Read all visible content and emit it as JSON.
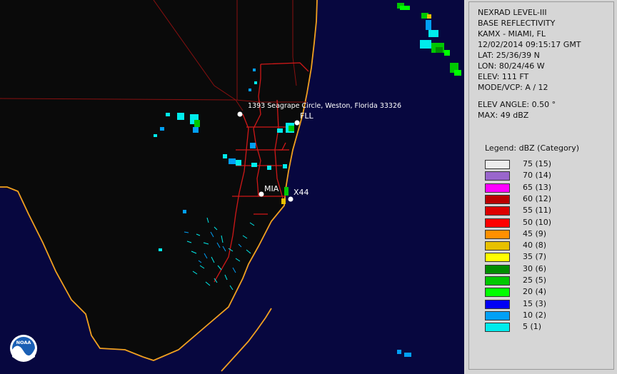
{
  "header": {
    "product": "NEXRAD LEVEL-III",
    "type": "BASE REFLECTIVITY",
    "station": "KAMX - MIAMI, FL",
    "datetime": "12/02/2014 09:15:17 GMT",
    "lat": "LAT: 25/36/39 N",
    "lon": "LON: 80/24/46 W",
    "elev": "ELEV: 111 FT",
    "mode": "MODE/VCP: A / 12",
    "elev_angle": "ELEV ANGLE: 0.50 °",
    "max": "MAX: 49 dBZ"
  },
  "legend": {
    "title": "Legend: dBZ (Category)",
    "items": [
      {
        "label": "75  (15)",
        "color": "#ececec"
      },
      {
        "label": "70  (14)",
        "color": "#9966cc"
      },
      {
        "label": "65  (13)",
        "color": "#ff00ff"
      },
      {
        "label": "60  (12)",
        "color": "#bb0000"
      },
      {
        "label": "55  (11)",
        "color": "#dd0000"
      },
      {
        "label": "50  (10)",
        "color": "#ff0000"
      },
      {
        "label": "45  (9)",
        "color": "#ff9000"
      },
      {
        "label": "40  (8)",
        "color": "#e7c000"
      },
      {
        "label": "35  (7)",
        "color": "#ffff00"
      },
      {
        "label": "30  (6)",
        "color": "#008e00"
      },
      {
        "label": "25  (5)",
        "color": "#00c800"
      },
      {
        "label": "20  (4)",
        "color": "#00ff00"
      },
      {
        "label": "15  (3)",
        "color": "#0000f6"
      },
      {
        "label": "10  (2)",
        "color": "#01a0f6"
      },
      {
        "label": "5  (1)",
        "color": "#00ecec"
      }
    ]
  },
  "map": {
    "address_label": "1393 Seagrape Circle, Weston, Florida 33326",
    "places": {
      "fll": "FLL",
      "mia": "MIA",
      "x44": "X44"
    },
    "logo_text": "NOAA",
    "colors": {
      "ocean": "#07073f",
      "land": "#0a0a0a",
      "coast": "#f0a020",
      "roads": "#cc1111",
      "counties": "#8a1010"
    }
  }
}
